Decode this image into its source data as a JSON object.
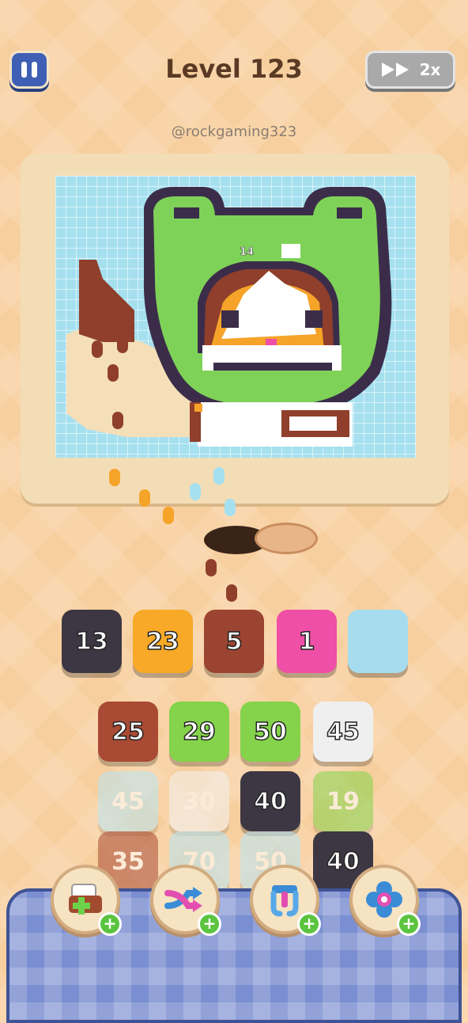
{
  "header": {
    "title": "Level 123",
    "watermark": "@rockgaming323",
    "speed_label": "2x"
  },
  "board": {
    "counter_label": "14"
  },
  "queue": [
    {
      "value": "13",
      "color": "#3d3743"
    },
    {
      "value": "23",
      "color": "#f7a927"
    },
    {
      "value": "5",
      "color": "#9c4432"
    },
    {
      "value": "1",
      "color": "#ef4fa6"
    },
    {
      "value": "",
      "color": "#a6dcee"
    }
  ],
  "grid": [
    [
      {
        "value": "25",
        "color": "#a94a35",
        "faded": false
      },
      {
        "value": "29",
        "color": "#84d34a",
        "faded": false
      },
      {
        "value": "50",
        "color": "#84d34a",
        "faded": false
      },
      {
        "value": "45",
        "color": "#efefef",
        "faded": false
      }
    ],
    [
      {
        "value": "45",
        "color": "#b8e6f4",
        "faded": true
      },
      {
        "value": "30",
        "color": "#f2f2f2",
        "faded": true
      },
      {
        "value": "40",
        "color": "#3d3743",
        "faded": false
      },
      {
        "value": "19",
        "color": "#84d34a",
        "faded": true
      }
    ],
    [
      {
        "value": "35",
        "color": "#a94a35",
        "faded": true
      },
      {
        "value": "70",
        "color": "#b8e6f4",
        "faded": true
      },
      {
        "value": "50",
        "color": "#b8e6f4",
        "faded": true
      },
      {
        "value": "40",
        "color": "#3d3743",
        "faded": false
      }
    ]
  ],
  "boosters": [
    {
      "name": "add-slot-booster",
      "icon": "add-tray-icon"
    },
    {
      "name": "shuffle-booster",
      "icon": "shuffle-icon"
    },
    {
      "name": "magnet-booster",
      "icon": "magnet-icon"
    },
    {
      "name": "sort-booster",
      "icon": "flower-icon"
    }
  ],
  "colors": {
    "frog_green": "#7fd258",
    "outline": "#3b2d4a",
    "orange": "#f6a329",
    "brown": "#8f3f2b",
    "sky": "#a6e0ef"
  }
}
